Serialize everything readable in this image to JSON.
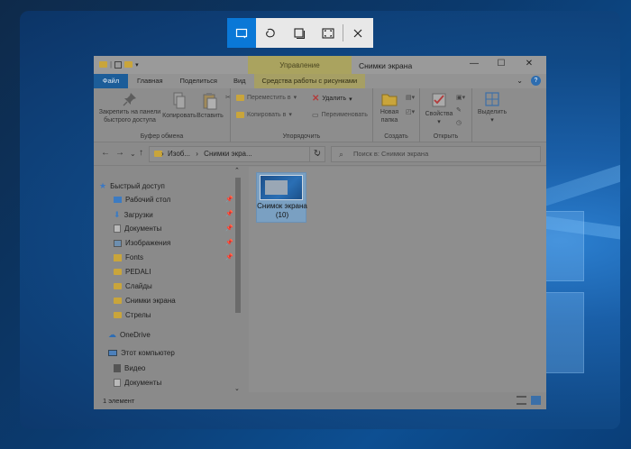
{
  "snip_toolbar": {
    "buttons": [
      {
        "name": "rectangular-snip",
        "active": true
      },
      {
        "name": "freeform-snip",
        "active": false
      },
      {
        "name": "window-snip",
        "active": false
      },
      {
        "name": "fullscreen-snip",
        "active": false
      },
      {
        "name": "close",
        "active": false
      }
    ]
  },
  "window": {
    "contextual_tab_title": "Управление",
    "title": "Снимки экрана",
    "controls": {
      "minimize": "—",
      "maximize": "☐",
      "close": "✕"
    }
  },
  "tabs": [
    "Файл",
    "Главная",
    "Поделиться",
    "Вид",
    "Средства работы с рисунками"
  ],
  "ribbon": {
    "clipboard": {
      "pin_label": "Закрепить на панели быстрого доступа",
      "copy_label": "Копировать",
      "paste_label": "Вставить",
      "group_label": "Буфер обмена"
    },
    "organize": {
      "move_to": "Переместить в",
      "copy_to": "Копировать в",
      "delete": "Удалить",
      "rename": "Переименовать",
      "group_label": "Упорядочить"
    },
    "create": {
      "new_folder": "Новая папка",
      "group_label": "Создать"
    },
    "open": {
      "properties": "Свойства",
      "group_label": "Открыть"
    },
    "select": {
      "select_label": "Выделить"
    }
  },
  "address": {
    "path_parts": [
      "Изоб...",
      "Снимки экра..."
    ],
    "search_placeholder": "Поиск в: Снимки экрана"
  },
  "nav": {
    "quick_access": "Быстрый доступ",
    "items": [
      {
        "label": "Рабочий стол",
        "pinned": true
      },
      {
        "label": "Загрузки",
        "pinned": true
      },
      {
        "label": "Документы",
        "pinned": true
      },
      {
        "label": "Изображения",
        "pinned": true
      },
      {
        "label": "Fonts",
        "pinned": true
      },
      {
        "label": "PEDALI",
        "pinned": false
      },
      {
        "label": "Слайды",
        "pinned": false
      },
      {
        "label": "Снимки экрана",
        "pinned": false
      },
      {
        "label": "Стрелы",
        "pinned": false
      }
    ],
    "onedrive": "OneDrive",
    "this_pc": "Этот компьютер",
    "pc_items": [
      "Видео",
      "Документы"
    ]
  },
  "files": [
    {
      "name": "Снимок экрана (10)",
      "selected": true
    }
  ],
  "status": {
    "count_text": "1 элемент"
  }
}
